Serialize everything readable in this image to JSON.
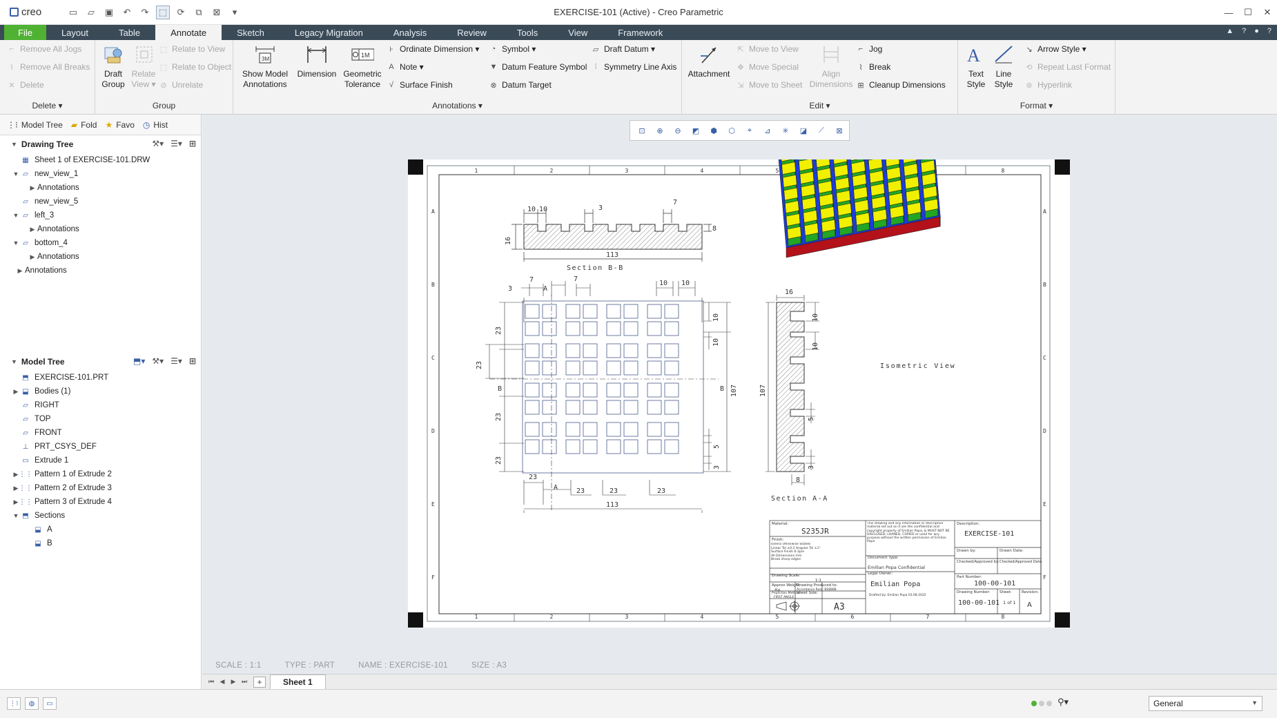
{
  "app": {
    "brand": "creo",
    "window_title": "EXERCISE-101 (Active) - Creo Parametric"
  },
  "menu_tabs": [
    {
      "label": "File"
    },
    {
      "label": "Layout"
    },
    {
      "label": "Table"
    },
    {
      "label": "Annotate"
    },
    {
      "label": "Sketch"
    },
    {
      "label": "Legacy Migration"
    },
    {
      "label": "Analysis"
    },
    {
      "label": "Review"
    },
    {
      "label": "Tools"
    },
    {
      "label": "View"
    },
    {
      "label": "Framework"
    }
  ],
  "ribbon": {
    "delete": {
      "remove_all_jogs": "Remove All Jogs",
      "remove_all_breaks": "Remove All Breaks",
      "delete": "Delete",
      "label": "Delete ▾"
    },
    "group": {
      "draft_group": "Draft\nGroup",
      "relate_view": "Relate\nView ▾",
      "relate_to_view": "Relate to View",
      "relate_to_object": "Relate to Object",
      "unrelate": "Unrelate",
      "label": "Group"
    },
    "annotations": {
      "show_model_annotations": "Show Model\nAnnotations",
      "dimension": "Dimension",
      "geometric_tolerance": "Geometric\nTolerance",
      "ordinate_dimension": "Ordinate Dimension ▾",
      "note": "Note ▾",
      "surface_finish": "Surface Finish",
      "symbol": "Symbol ▾",
      "datum_feature_symbol": "Datum Feature Symbol",
      "datum_target": "Datum Target",
      "draft_datum": "Draft Datum ▾",
      "symmetry_line_axis": "Symmetry Line Axis",
      "label": "Annotations ▾"
    },
    "edit": {
      "attachment": "Attachment",
      "move_to_view": "Move to View",
      "move_special": "Move Special",
      "move_to_sheet": "Move to Sheet",
      "align_dimensions": "Align\nDimensions",
      "jog": "Jog",
      "break": "Break",
      "cleanup_dimensions": "Cleanup Dimensions",
      "label": "Edit ▾"
    },
    "format": {
      "text_style": "Text\nStyle",
      "line_style": "Line\nStyle",
      "arrow_style": "Arrow Style ▾",
      "repeat_last_format": "Repeat Last Format",
      "hyperlink": "Hyperlink",
      "label": "Format ▾"
    }
  },
  "nav_tabs": [
    {
      "label": "Model Tree"
    },
    {
      "label": "Fold"
    },
    {
      "label": "Favo"
    },
    {
      "label": "Hist"
    }
  ],
  "drawing_tree": {
    "title": "Drawing Tree",
    "items": [
      {
        "label": "Sheet 1 of EXERCISE-101.DRW",
        "level": 0,
        "tw": "",
        "icon": "sheet"
      },
      {
        "label": "new_view_1",
        "level": 0,
        "tw": "▼",
        "icon": "view"
      },
      {
        "label": "Annotations",
        "level": 1,
        "tw": "▶",
        "icon": ""
      },
      {
        "label": "new_view_5",
        "level": 0,
        "tw": "",
        "icon": "view"
      },
      {
        "label": "left_3",
        "level": 0,
        "tw": "▼",
        "icon": "view"
      },
      {
        "label": "Annotations",
        "level": 1,
        "tw": "▶",
        "icon": ""
      },
      {
        "label": "bottom_4",
        "level": 0,
        "tw": "▼",
        "icon": "view"
      },
      {
        "label": "Annotations",
        "level": 1,
        "tw": "▶",
        "icon": ""
      },
      {
        "label": "Annotations",
        "level": -1,
        "tw": "▶",
        "icon": ""
      }
    ]
  },
  "model_tree": {
    "title": "Model Tree",
    "items": [
      {
        "label": "EXERCISE-101.PRT",
        "level": 0,
        "tw": "",
        "icon": "part"
      },
      {
        "label": "Bodies (1)",
        "level": 0,
        "tw": "▶",
        "icon": "body"
      },
      {
        "label": "RIGHT",
        "level": 0,
        "tw": "",
        "icon": "plane"
      },
      {
        "label": "TOP",
        "level": 0,
        "tw": "",
        "icon": "plane"
      },
      {
        "label": "FRONT",
        "level": 0,
        "tw": "",
        "icon": "plane"
      },
      {
        "label": "PRT_CSYS_DEF",
        "level": 0,
        "tw": "",
        "icon": "csys"
      },
      {
        "label": "Extrude 1",
        "level": 0,
        "tw": "",
        "icon": "extrude"
      },
      {
        "label": "Pattern 1 of Extrude 2",
        "level": 0,
        "tw": "▶",
        "icon": "pattern"
      },
      {
        "label": "Pattern 2 of Extrude 3",
        "level": 0,
        "tw": "▶",
        "icon": "pattern"
      },
      {
        "label": "Pattern 3 of Extrude 4",
        "level": 0,
        "tw": "▶",
        "icon": "pattern"
      },
      {
        "label": "Sections",
        "level": 0,
        "tw": "▼",
        "icon": "sections"
      },
      {
        "label": "A",
        "level": 1,
        "tw": "",
        "icon": "xsec"
      },
      {
        "label": "B",
        "level": 1,
        "tw": "",
        "icon": "xsec"
      }
    ]
  },
  "drawing": {
    "col_numbers": [
      "1",
      "2",
      "3",
      "4",
      "5",
      "6",
      "7",
      "8"
    ],
    "row_letters": [
      "A",
      "B",
      "C",
      "D",
      "E",
      "F"
    ],
    "section_bb": {
      "label": "Section B-B",
      "dims": [
        "10",
        "10",
        "3",
        "7",
        "16",
        "8",
        "113"
      ]
    },
    "front_view": {
      "dims_top": [
        "3",
        "7",
        "A",
        "7",
        "10",
        "10"
      ],
      "dims_left": [
        "23",
        "23",
        "23",
        "23"
      ],
      "dims_bottom": [
        "23",
        "A",
        "23",
        "23",
        "23"
      ],
      "overall": "113",
      "right": [
        "10",
        "10",
        "107",
        "5",
        "3"
      ],
      "b_marks": [
        "B",
        "B"
      ]
    },
    "section_aa": {
      "label": "Section A-A",
      "dims": [
        "16",
        "10",
        "10",
        "5",
        "3",
        "107",
        "8"
      ]
    },
    "iso_label": "Isometric View",
    "title_block": {
      "material_label": "Material:",
      "material": "S235JR",
      "finish_label": "Finish:",
      "notes": "Unless Otherwise Stated:\nLinear Tol ±0.2 Angular Tol ±1°\nSurface Finish 6.3μm\nAll Dimensions mm\nBreak sharp edges",
      "scale_label": "Drawing Scale:",
      "scale": "1:1",
      "weight_label": "Approx Weight:",
      "weight": "-Kg",
      "produced_label": "Drawing Produced to:",
      "produced": "Accordance Rule: BS8888",
      "projection_label": "Projection Method:",
      "projection": "FIRST ANGLE",
      "sheet_size_label": "Sheet Size:",
      "sheet_size": "A3",
      "legal": "This drawing and any information or descriptive material set out on it are the confidential and copyright property of Emilian Popa, & MUST NOT BE DISCLOSED, LOANED, COPIED or used for any purpose without the written permission of Emilian Popa",
      "doc_type_label": "Document Type:",
      "doc_type": "Emilian Popa Confidential",
      "legal_owner_label": "Legal Owner:",
      "legal_owner": "Emilian Popa",
      "checked": "Drafted by: Emilian Popa 03.08.2022",
      "desc_label": "Description:",
      "description": "EXERCISE-101",
      "drawn_by_label": "Drawn by:",
      "drawn_date_label": "Drawn Date:",
      "checked_by_label": "Checked/Approved by:",
      "checked_date_label": "Checked/Approved Date:",
      "part_number_label": "Part Number:",
      "part_number": "100-00-101",
      "drawing_number_label": "Drawing Number:",
      "drawing_number": "100-00-101",
      "sheet_label": "Sheet:",
      "sheet": "1 of 1",
      "revision_label": "Revision:",
      "revision": "A"
    }
  },
  "sheet_info": {
    "scale": "SCALE : 1:1",
    "type": "TYPE : PART",
    "name": "NAME : EXERCISE-101",
    "size": "SIZE : A3"
  },
  "sheet_tab": "Sheet 1",
  "status": {
    "filter": "General"
  },
  "colors": {
    "file_tab": "#4fb233",
    "tab_bar": "#3b4a57",
    "iso_yellow": "#f0f000",
    "iso_green": "#23a623",
    "iso_blue": "#1e3cd6",
    "iso_red": "#b3121b"
  }
}
